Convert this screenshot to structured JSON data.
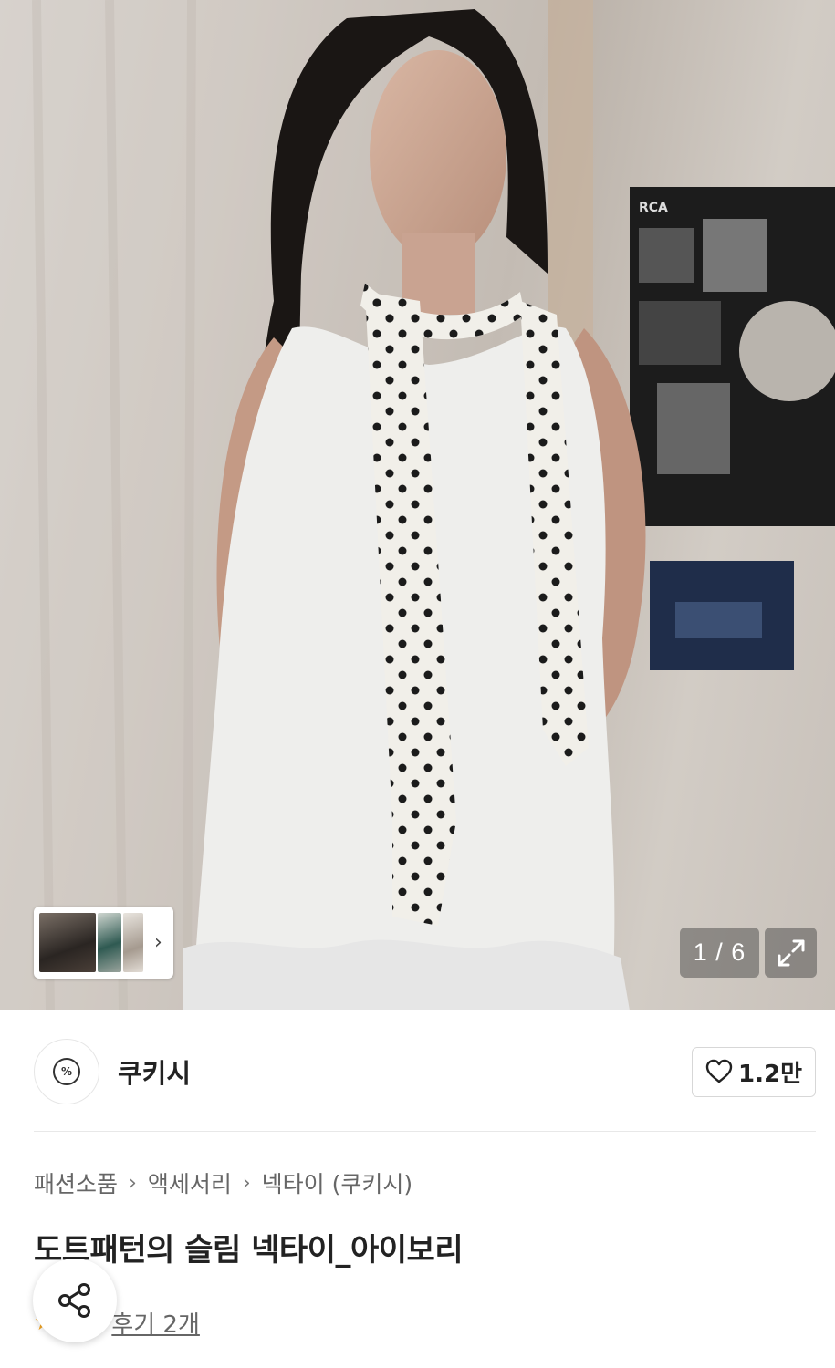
{
  "gallery": {
    "counter": "1 / 6",
    "thumb_arrow": "›",
    "poster_text": "RCA"
  },
  "shop": {
    "name": "쿠키시",
    "logo_text": "%",
    "like_count": "1.2만"
  },
  "breadcrumb": {
    "items": [
      "패션소품",
      "액세서리",
      "넥타이 (쿠키시)"
    ],
    "separator": "›"
  },
  "product": {
    "title": "도트패턴의 슬림 넥타이_아이보리"
  },
  "reviews": {
    "star": "★",
    "label": "후기 2개"
  },
  "colors": {
    "accent_star": "#f5a623",
    "text_primary": "#222222",
    "text_secondary": "#666666"
  },
  "icons": [
    "chevron-right-icon",
    "expand-icon",
    "heart-icon",
    "share-icon",
    "star-icon"
  ]
}
